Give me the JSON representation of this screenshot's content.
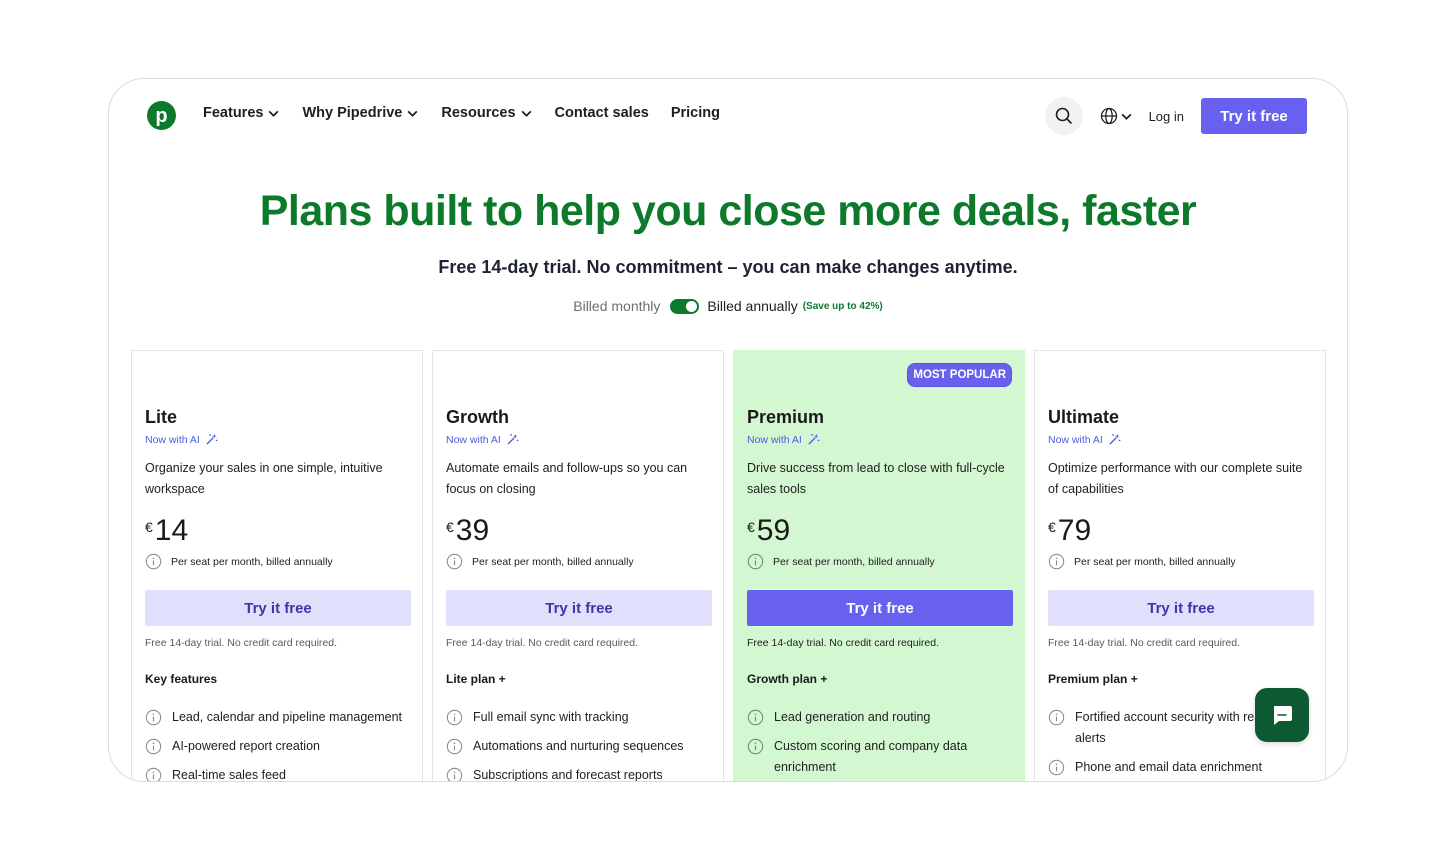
{
  "brand": {
    "logo_letter": "p",
    "accent": "#0c7a2a",
    "button_purple": "#6861f0",
    "popular_bg": "#d3f7d1"
  },
  "nav": {
    "links": [
      {
        "label": "Features",
        "has_dropdown": true
      },
      {
        "label": "Why Pipedrive",
        "has_dropdown": true
      },
      {
        "label": "Resources",
        "has_dropdown": true
      },
      {
        "label": "Contact sales",
        "has_dropdown": false
      },
      {
        "label": "Pricing",
        "has_dropdown": false
      }
    ],
    "login": "Log in",
    "cta": "Try it free",
    "icons": [
      "search-icon",
      "globe-icon"
    ]
  },
  "hero": {
    "title": "Plans built to help you close more deals, faster",
    "subtitle": "Free 14-day trial. No commitment – you can make changes anytime.",
    "billing": {
      "monthly_label": "Billed monthly",
      "annual_label": "Billed annually",
      "save_label": "(Save up to 42%)",
      "selected": "annually"
    }
  },
  "plans": [
    {
      "name": "Lite",
      "ai_tag": "Now with AI",
      "description": "Organize your sales in one simple, intuitive workspace",
      "currency": "€",
      "price": "14",
      "billing_note": "Per seat per month, billed annually",
      "button": "Try it free",
      "trial_note": "Free 14-day trial. No credit card required.",
      "features_title": "Key features",
      "features": [
        "Lead, calendar and pipeline management",
        "AI-powered report creation",
        "Real-time sales feed"
      ],
      "highlight": false
    },
    {
      "name": "Growth",
      "ai_tag": "Now with AI",
      "description": "Automate emails and follow-ups so you can focus on closing",
      "currency": "€",
      "price": "39",
      "billing_note": "Per seat per month, billed annually",
      "button": "Try it free",
      "trial_note": "Free 14-day trial. No credit card required.",
      "features_title": "Lite plan +",
      "features": [
        "Full email sync with tracking",
        "Automations and nurturing sequences",
        "Subscriptions and forecast reports"
      ],
      "highlight": false
    },
    {
      "name": "Premium",
      "badge": "MOST POPULAR",
      "ai_tag": "Now with AI",
      "description": "Drive success from lead to close with full-cycle sales tools",
      "currency": "€",
      "price": "59",
      "billing_note": "Per seat per month, billed annually",
      "button": "Try it free",
      "trial_note": "Free 14-day trial. No credit card required.",
      "features_title": "Growth plan +",
      "features": [
        "Lead generation and routing",
        "Custom scoring and company data enrichment"
      ],
      "highlight": true
    },
    {
      "name": "Ultimate",
      "ai_tag": "Now with AI",
      "description": "Optimize performance with our complete suite of capabilities",
      "currency": "€",
      "price": "79",
      "billing_note": "Per seat per month, billed annually",
      "button": "Try it free",
      "trial_note": "Free 14-day trial. No credit card required.",
      "features_title": "Premium plan +",
      "features": [
        "Fortified account security with real-time alerts",
        "Phone and email data enrichment"
      ],
      "highlight": false
    }
  ]
}
